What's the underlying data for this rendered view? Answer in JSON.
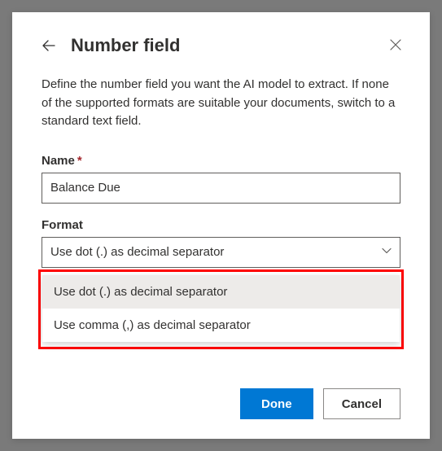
{
  "header": {
    "title": "Number field"
  },
  "description": "Define the number field you want the AI model to extract. If none of the supported formats are suitable your documents, switch to a standard text field.",
  "fields": {
    "name": {
      "label": "Name",
      "required_mark": "*",
      "value": "Balance Due"
    },
    "format": {
      "label": "Format",
      "selected": "Use dot (.) as decimal separator",
      "options": [
        "Use dot (.) as decimal separator",
        "Use comma (,) as decimal separator"
      ]
    }
  },
  "footer": {
    "done": "Done",
    "cancel": "Cancel"
  }
}
